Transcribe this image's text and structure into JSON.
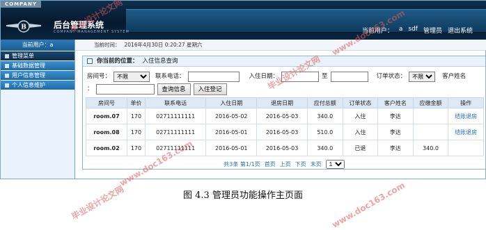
{
  "header": {
    "company": "COMPANY",
    "title": "后台管理系统",
    "subtitle": "COMPANY MANAGEMENT SYSTEM",
    "nav": {
      "current_user_label": "当前用户：",
      "user": "a",
      "sdf": "sdf",
      "admin": "管理员",
      "logout": "退出系统"
    }
  },
  "sidebar": {
    "user_label": "当前用户：a",
    "items": [
      {
        "label": "管理菜单"
      },
      {
        "label": "基础数据管理"
      },
      {
        "label": "用户信息管理"
      },
      {
        "label": "个人信息维护"
      }
    ]
  },
  "topbar": {
    "label": "当前时间：",
    "time": "2016年4月30日 0:20:27 星期六"
  },
  "panel": {
    "position_label": "你当前的位置：",
    "position": "入住信息查询"
  },
  "filters": {
    "room_label": "房间号：",
    "room_value": "不限",
    "phone_label": "联系电话：",
    "checkin_label": "入住日期：",
    "to_label": "至",
    "order_status_label": "订单状态：",
    "order_status_value": "不限",
    "guest_label": "客户姓名",
    "colon": "：",
    "query_btn": "查询信息",
    "checkin_btn": "入住登记"
  },
  "table": {
    "headers": [
      "房间号",
      "单价",
      "联系电话",
      "入住日期",
      "退房日期",
      "应付总额",
      "订单状态",
      "客户姓名",
      "应缴金额",
      "操作"
    ],
    "rows": [
      [
        "room.07",
        "170",
        "02711111111",
        "2016-05-02",
        "2016-05-03",
        "340.0",
        "入住",
        "李达",
        "",
        "结账退房"
      ],
      [
        "room.08",
        "170",
        "02711111111",
        "2016-05-01",
        "2016-05-03",
        "510.0",
        "入住",
        "李达",
        "",
        "结账退房"
      ],
      [
        "room.02",
        "170",
        "02711111111",
        "2016-05-01",
        "2016-05-03",
        "340.0",
        "已退",
        "李达",
        "340.0",
        ""
      ]
    ]
  },
  "pager": {
    "summary": "共3条 第1/1页",
    "first": "首页",
    "prev": "上页",
    "next": "下页",
    "last": "末页",
    "page": "1"
  },
  "caption": "图 4.3 管理员功能操作主页面",
  "watermarks": [
    "毕业设计论文网",
    "www.doc163.com",
    "毕业设计论文网",
    "www.doc163.com",
    "毕业设计论文网",
    "www.doc163.com"
  ]
}
